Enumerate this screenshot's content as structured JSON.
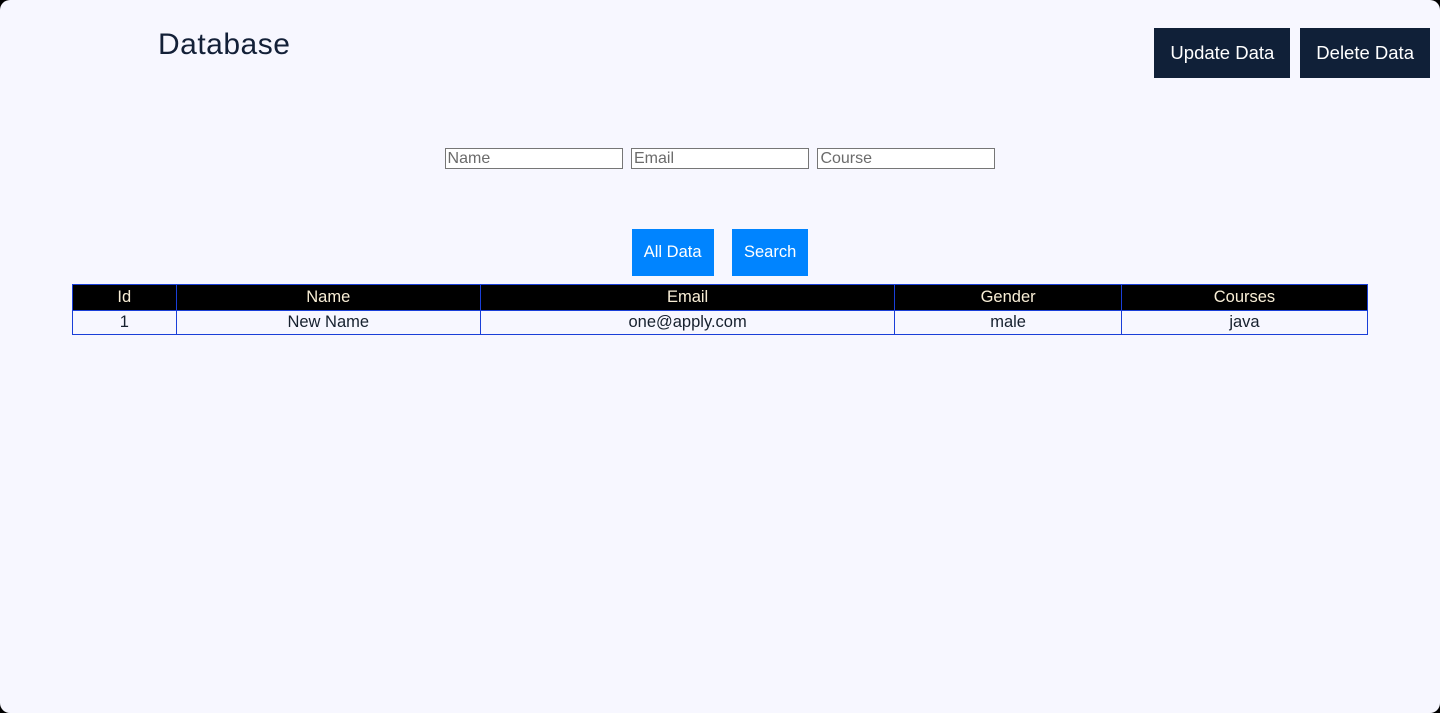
{
  "header": {
    "title": "Database",
    "update_label": "Update Data",
    "delete_label": "Delete Data"
  },
  "search": {
    "name_placeholder": "Name",
    "email_placeholder": "Email",
    "course_placeholder": "Course",
    "name_value": "",
    "email_value": "",
    "course_value": ""
  },
  "actions": {
    "all_data_label": "All Data",
    "search_label": "Search"
  },
  "table": {
    "headers": {
      "id": "Id",
      "name": "Name",
      "email": "Email",
      "gender": "Gender",
      "courses": "Courses"
    },
    "rows": [
      {
        "id": "1",
        "name": "New Name",
        "email": "one@apply.com",
        "gender": "male",
        "courses": "java"
      }
    ]
  }
}
